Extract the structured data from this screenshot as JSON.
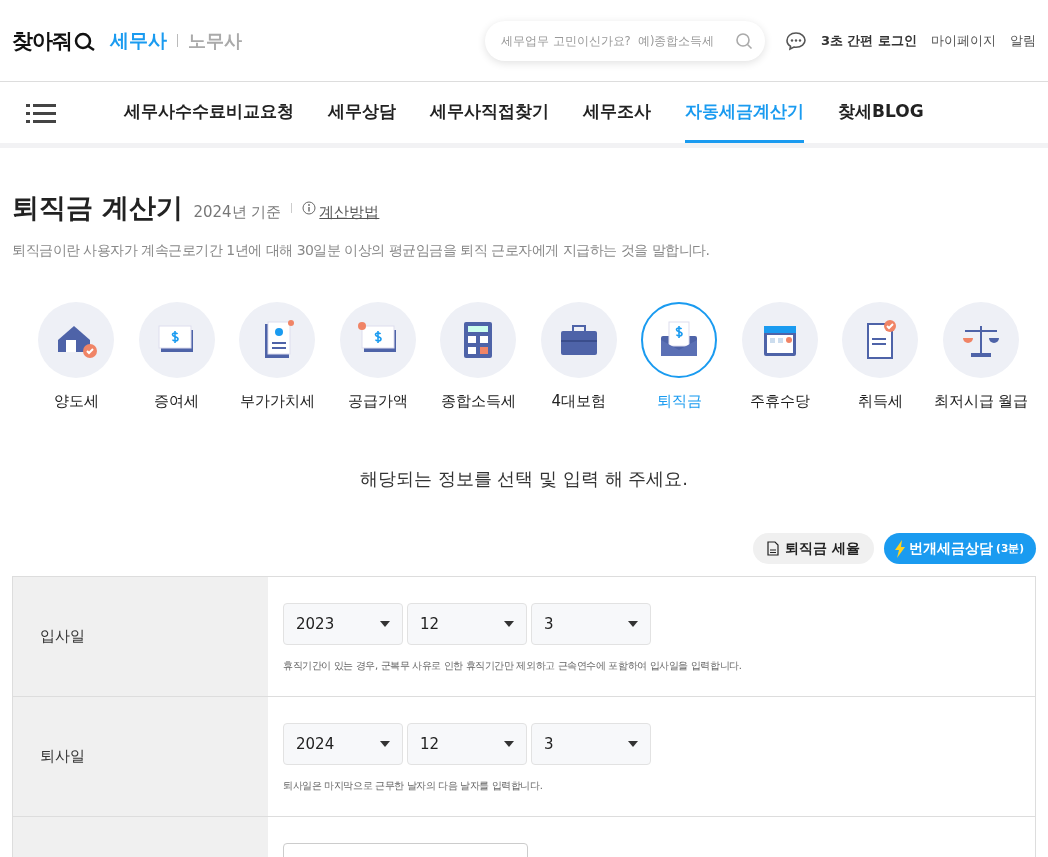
{
  "header": {
    "logo": "찾아줘",
    "service_active": "세무사",
    "service_other": "노무사",
    "search": {
      "placeholder": "세무업무 고민이신가요?  예)종합소득세"
    },
    "login": "3초 간편 로그인",
    "mypage": "마이페이지",
    "alerts": "알림"
  },
  "nav": [
    {
      "label": "세무사수수료비교요청",
      "selected": false
    },
    {
      "label": "세무상담",
      "selected": false
    },
    {
      "label": "세무사직접찾기",
      "selected": false
    },
    {
      "label": "세무조사",
      "selected": false
    },
    {
      "label": "자동세금계산기",
      "selected": true
    },
    {
      "label": "찾세BLOG",
      "selected": false
    }
  ],
  "title": "퇴직금 계산기",
  "basis": "2024년 기준",
  "method_link": "계산방법",
  "description": "퇴직금이란 사용자가 계속근로기간 1년에 대해 30일분 이상의 평균임금을 퇴직 근로자에게 지급하는 것을 말합니다.",
  "calculators": [
    {
      "label": "양도세",
      "kind": "house",
      "selected": false
    },
    {
      "label": "증여세",
      "kind": "cash",
      "selected": false
    },
    {
      "label": "부가가치세",
      "kind": "idcard",
      "selected": false
    },
    {
      "label": "공급가액",
      "kind": "cashminus",
      "selected": false
    },
    {
      "label": "종합소득세",
      "kind": "calculator",
      "selected": false
    },
    {
      "label": "4대보험",
      "kind": "briefcase",
      "selected": false
    },
    {
      "label": "퇴직금",
      "kind": "envelope",
      "selected": true
    },
    {
      "label": "주휴수당",
      "kind": "calendar",
      "selected": false
    },
    {
      "label": "취득세",
      "kind": "receipt",
      "selected": false
    },
    {
      "label": "최저시급 월급",
      "kind": "scale",
      "selected": false
    }
  ],
  "prompt": "해당되는 정보를 선택 및 입력 해 주세요.",
  "rate_button": "퇴직금 세율",
  "consult_button": {
    "label": "번개세금상담",
    "note": "(3분)"
  },
  "form_rows": [
    {
      "label": "입사일",
      "kind": "date",
      "year": "2023",
      "month": "12",
      "day": "3",
      "hint": "휴직기간이 있는 경우, 군복무 사유로 인한 휴직기간만 제외하고 근속연수에 포함하여 입사일을 입력합니다."
    },
    {
      "label": "퇴사일",
      "kind": "date",
      "year": "2024",
      "month": "12",
      "day": "3",
      "hint": "퇴사일은 마지막으로 근무한 날자의 다음 날자를 입력합니다."
    },
    {
      "kind": "input"
    }
  ]
}
